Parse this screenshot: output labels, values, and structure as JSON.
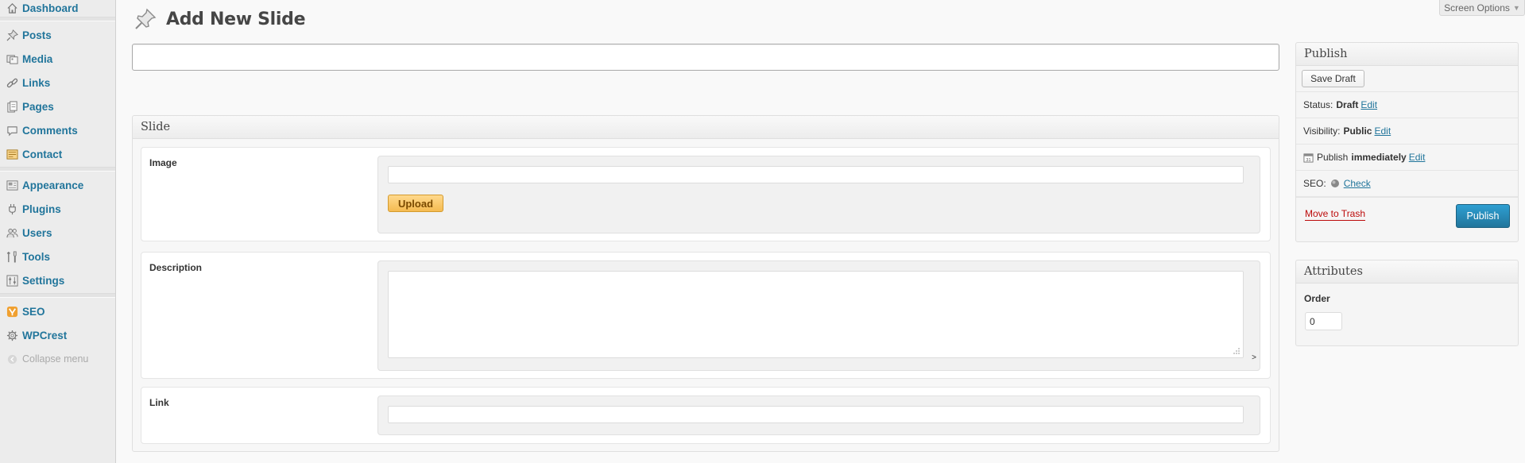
{
  "sidebar": {
    "items": [
      {
        "label": "Dashboard",
        "icon": "dashboard-icon"
      },
      {
        "label": "Posts",
        "icon": "pushpin-icon"
      },
      {
        "label": "Media",
        "icon": "media-icon"
      },
      {
        "label": "Links",
        "icon": "link-icon"
      },
      {
        "label": "Pages",
        "icon": "pages-icon"
      },
      {
        "label": "Comments",
        "icon": "comment-icon"
      },
      {
        "label": "Contact",
        "icon": "contact-icon"
      },
      {
        "label": "Appearance",
        "icon": "appearance-icon"
      },
      {
        "label": "Plugins",
        "icon": "plugin-icon"
      },
      {
        "label": "Users",
        "icon": "users-icon"
      },
      {
        "label": "Tools",
        "icon": "tools-icon"
      },
      {
        "label": "Settings",
        "icon": "settings-icon"
      },
      {
        "label": "SEO",
        "icon": "seo-icon"
      },
      {
        "label": "WPCrest",
        "icon": "gear-icon"
      }
    ],
    "collapse_label": "Collapse menu"
  },
  "header": {
    "screen_options": "Screen Options",
    "page_title": "Add New Slide"
  },
  "title_field": {
    "value": ""
  },
  "slide_box": {
    "title": "Slide",
    "image_label": "Image",
    "image_value": "",
    "upload_label": "Upload",
    "description_label": "Description",
    "description_value": "",
    "description_suffix": ">",
    "link_label": "Link",
    "link_value": ""
  },
  "publish_box": {
    "title": "Publish",
    "save_draft_label": "Save Draft",
    "status_label": "Status:",
    "status_value": "Draft",
    "visibility_label": "Visibility:",
    "visibility_value": "Public",
    "publish_label": "Publish",
    "publish_value": "immediately",
    "edit_label": "Edit",
    "seo_label": "SEO:",
    "seo_check": "Check",
    "trash_label": "Move to Trash",
    "publish_button": "Publish"
  },
  "attributes_box": {
    "title": "Attributes",
    "order_label": "Order",
    "order_value": "0"
  },
  "colors": {
    "link": "#21759b",
    "publish_button": "#21759b",
    "upload_button": "#f5bb51",
    "trash": "#bc0b0b"
  }
}
